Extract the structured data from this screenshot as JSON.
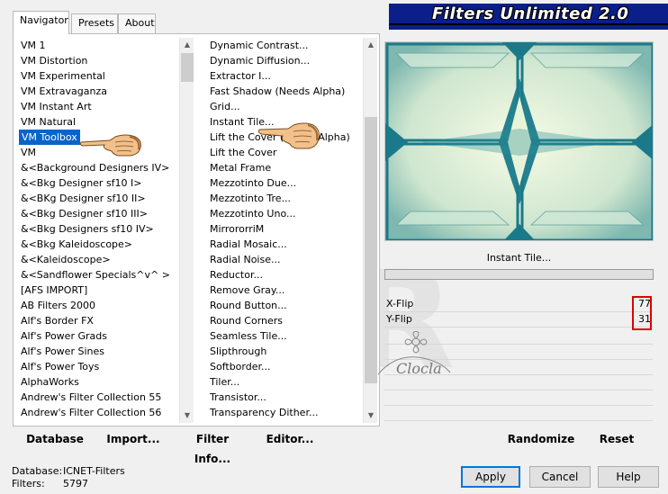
{
  "tabs": [
    {
      "label": "Navigator",
      "active": true
    },
    {
      "label": "Presets",
      "active": false
    },
    {
      "label": "About",
      "active": false
    }
  ],
  "banner_title": "Filters Unlimited 2.0",
  "categories": [
    "VM 1",
    "VM Distortion",
    "VM Experimental",
    "VM Extravaganza",
    "VM Instant Art",
    "VM Natural",
    "VM Toolbox",
    "VM",
    "&<Background Designers IV>",
    "&<Bkg Designer sf10 I>",
    "&<BKg Designer sf10 II>",
    "&<Bkg Designer sf10 III>",
    "&<Bkg Designers sf10 IV>",
    "&<Bkg Kaleidoscope>",
    "&<Kaleidoscope>",
    "&<Sandflower Specials^v^ >",
    "[AFS IMPORT]",
    "AB Filters 2000",
    "Alf's Border FX",
    "Alf's Power Grads",
    "Alf's Power Sines",
    "Alf's Power Toys",
    "AlphaWorks",
    "Andrew's Filter Collection 55",
    "Andrew's Filter Collection 56"
  ],
  "selected_category": "VM Toolbox",
  "filters": [
    "Dynamic Contrast...",
    "Dynamic Diffusion...",
    "Extractor I...",
    "Fast Shadow (Needs Alpha)",
    "Grid...",
    "Instant Tile...",
    "Lift the Cover (Needs Alpha)",
    "Lift the Cover",
    "Metal Frame",
    "Mezzotinto Due...",
    "Mezzotinto Tre...",
    "Mezzotinto Uno...",
    "MirrororriM",
    "Radial Mosaic...",
    "Radial Noise...",
    "Reductor...",
    "Remove Gray...",
    "Round Button...",
    "Round Corners",
    "Seamless Tile...",
    "Slipthrough",
    "Softborder...",
    "Tiler...",
    "Transistor...",
    "Transparency Dither..."
  ],
  "selected_filter": "Instant Tile...",
  "filter_name_display": "Instant Tile...",
  "params": [
    {
      "label": "X-Flip",
      "value": "77"
    },
    {
      "label": "Y-Flip",
      "value": "31"
    }
  ],
  "bottom_left_buttons": {
    "database": "Database",
    "import": "Import...",
    "filter_info": "Filter Info...",
    "editor": "Editor..."
  },
  "right_buttons": {
    "randomize": "Randomize",
    "reset": "Reset"
  },
  "status": {
    "database_label": "Database:",
    "database_value": "ICNET-Filters",
    "filters_label": "Filters:",
    "filters_value": "5797"
  },
  "dialog_buttons": {
    "apply": "Apply",
    "cancel": "Cancel",
    "help": "Help"
  },
  "watermark": "OVER",
  "signature": "Clocla",
  "colors": {
    "selection": "#0a64c8",
    "banner": "#0a1f8a",
    "highlight_box": "#e00000",
    "preview_teal": "#1a7a8a",
    "preview_light": "#e8f4d8"
  }
}
